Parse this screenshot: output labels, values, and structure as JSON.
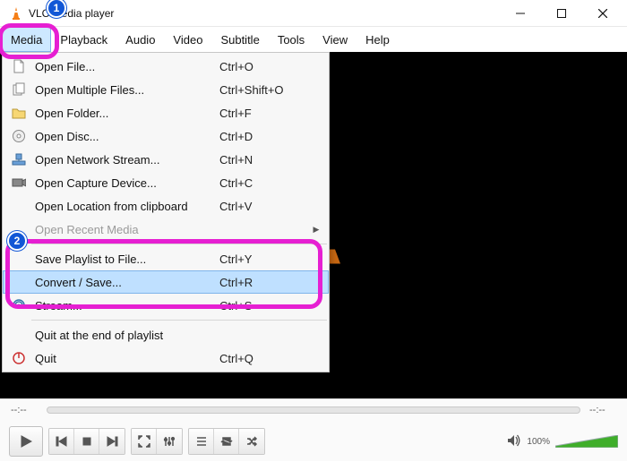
{
  "window": {
    "title": "VLC media player"
  },
  "menubar": [
    "Media",
    "Playback",
    "Audio",
    "Video",
    "Subtitle",
    "Tools",
    "View",
    "Help"
  ],
  "active_menu_index": 0,
  "dropdown": {
    "items": [
      {
        "icon": "file",
        "label": "Open File...",
        "shortcut": "Ctrl+O"
      },
      {
        "icon": "files",
        "label": "Open Multiple Files...",
        "shortcut": "Ctrl+Shift+O"
      },
      {
        "icon": "folder",
        "label": "Open Folder...",
        "shortcut": "Ctrl+F"
      },
      {
        "icon": "disc",
        "label": "Open Disc...",
        "shortcut": "Ctrl+D"
      },
      {
        "icon": "network",
        "label": "Open Network Stream...",
        "shortcut": "Ctrl+N"
      },
      {
        "icon": "capture",
        "label": "Open Capture Device...",
        "shortcut": "Ctrl+C"
      },
      {
        "icon": "",
        "label": "Open Location from clipboard",
        "shortcut": "Ctrl+V"
      },
      {
        "icon": "",
        "label": "Open Recent Media",
        "shortcut": "",
        "submenu": true,
        "disabled": true
      },
      {
        "sep": true
      },
      {
        "icon": "",
        "label": "Save Playlist to File...",
        "shortcut": "Ctrl+Y"
      },
      {
        "icon": "",
        "label": "Convert / Save...",
        "shortcut": "Ctrl+R",
        "hover": true
      },
      {
        "icon": "stream",
        "label": "Stream...",
        "shortcut": "Ctrl+S"
      },
      {
        "sep": true
      },
      {
        "icon": "",
        "label": "Quit at the end of playlist",
        "shortcut": ""
      },
      {
        "icon": "quit",
        "label": "Quit",
        "shortcut": "Ctrl+Q"
      }
    ]
  },
  "time": {
    "elapsed": "--:--",
    "total": "--:--"
  },
  "volume": {
    "percent_label": "100%"
  },
  "markers": {
    "one": "1",
    "two": "2"
  }
}
